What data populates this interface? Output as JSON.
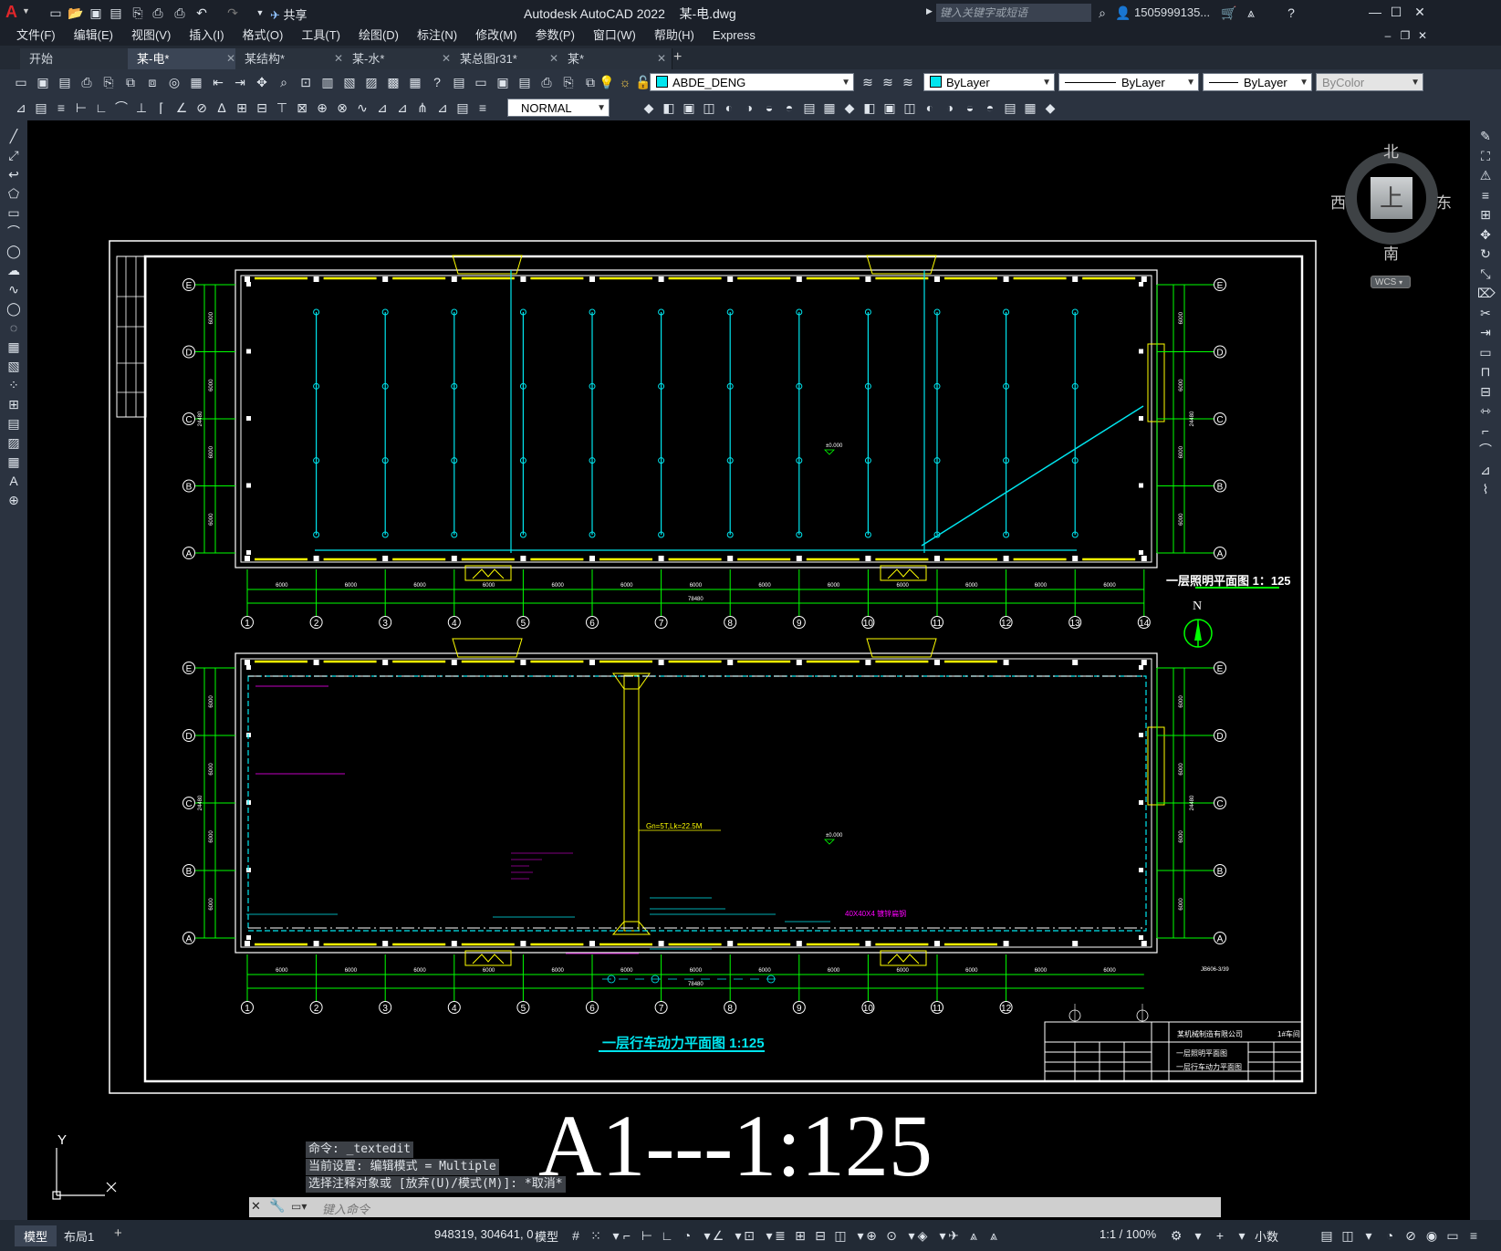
{
  "app": {
    "title": "Autodesk AutoCAD 2022    某-电.dwg",
    "share_label": "共享",
    "search_placeholder": "键入关键字或短语",
    "user": "1505999135...",
    "logo_letter": "A"
  },
  "menu": [
    "文件(F)",
    "编辑(E)",
    "视图(V)",
    "插入(I)",
    "格式(O)",
    "工具(T)",
    "绘图(D)",
    "标注(N)",
    "修改(M)",
    "参数(P)",
    "窗口(W)",
    "帮助(H)",
    "Express"
  ],
  "tabs": [
    {
      "label": "开始",
      "active": false,
      "closable": false
    },
    {
      "label": "某-电*",
      "active": true,
      "closable": true
    },
    {
      "label": "某结构*",
      "active": false,
      "closable": true
    },
    {
      "label": "某-水*",
      "active": false,
      "closable": true
    },
    {
      "label": "某总图r31*",
      "active": false,
      "closable": true
    },
    {
      "label": "某*",
      "active": false,
      "closable": true
    }
  ],
  "toolbar": {
    "layer": "ABDE_DENG",
    "color": "ByLayer",
    "linetype": "ByLayer",
    "lineweight": "ByLayer",
    "plotstyle": "ByColor",
    "textstyle": "NORMAL",
    "layer_color": "#00e5ee"
  },
  "viewcube": {
    "north": "北",
    "south": "南",
    "east": "东",
    "west": "西",
    "face": "上",
    "wcs": "WCS"
  },
  "drawing": {
    "plan1_title": "一层照明平面图 1：125",
    "plan2_title": "一层行车动力平面图 1:125",
    "north_label": "N",
    "row_labels": [
      "E",
      "D",
      "C",
      "B",
      "A"
    ],
    "col_labels": [
      "1",
      "2",
      "3",
      "4",
      "5",
      "6",
      "7",
      "8",
      "9",
      "10",
      "11",
      "12",
      "13",
      "14"
    ],
    "span_label": "6000",
    "total_label": "78480",
    "side_dims": [
      "6000",
      "6000",
      "6000",
      "6000"
    ],
    "side_total": "24480",
    "elev": "±0.000",
    "crane_label": "Gn=5T,Lk=22.5M",
    "bus_label": "40X40X4 镀锌扁钢",
    "scale_big": "A1---1:125",
    "company": "某机械制造有限公司",
    "workshop": "1#车间",
    "sheet1": "一层照明平面图",
    "sheet2": "一层行车动力平面图",
    "ref_note": "JB606-3/39"
  },
  "command": {
    "history": [
      "命令: _textedit",
      "当前设置: 编辑模式 = Multiple",
      "选择注释对象或 [放弃(U)/模式(M)]: *取消*"
    ],
    "placeholder": "键入命令"
  },
  "ucs": {
    "y": "Y",
    "x": "X"
  },
  "status": {
    "layout_tabs": [
      "模型",
      "布局1"
    ],
    "coords": "948319, 304641, 0",
    "model": "模型",
    "scale": "1:1 / 100%",
    "units": "小数"
  },
  "colors": {
    "accent": "#00e5ee",
    "grid": "#00ff00",
    "text_yellow": "#ffff00",
    "magenta": "#ff00ff"
  }
}
